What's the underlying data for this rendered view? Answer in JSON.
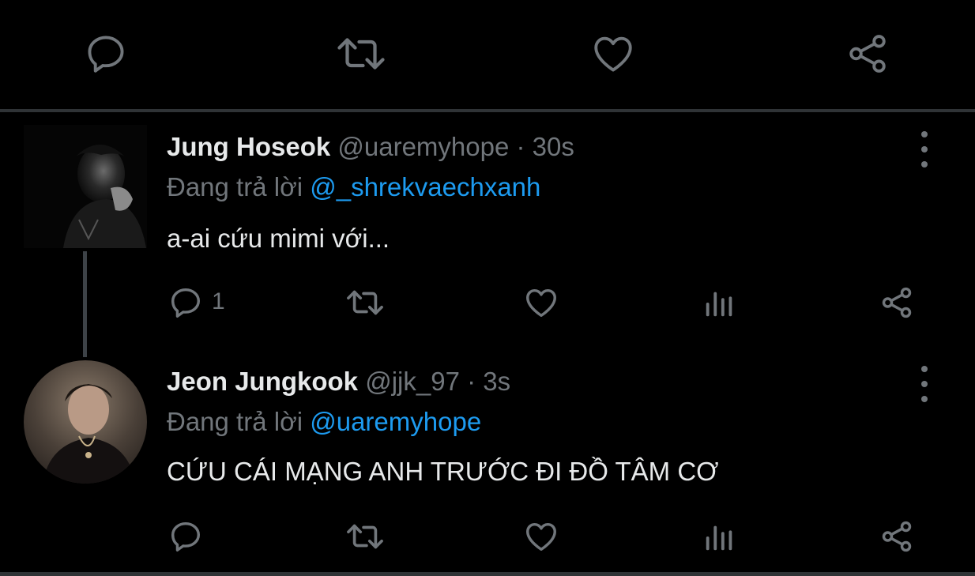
{
  "top_actions": {
    "reply_icon": "reply-icon",
    "retweet_icon": "retweet-icon",
    "like_icon": "heart-icon",
    "share_icon": "share-icon"
  },
  "tweets": [
    {
      "name": "Jung Hoseok",
      "handle": "@uaremyhope",
      "separator": "·",
      "time": "30s",
      "reply_prefix": "Đang trả lời",
      "reply_to": "@_shrekvaechxanh",
      "text": "a-ai cứu mimi với...",
      "reply_count": "1"
    },
    {
      "name": "Jeon Jungkook",
      "handle": "@jjk_97",
      "separator": "·",
      "time": "3s",
      "reply_prefix": "Đang trả lời",
      "reply_to": "@uaremyhope",
      "text": "CỨU CÁI MẠNG ANH TRƯỚC ĐI ĐỒ TÂM CƠ",
      "reply_count": ""
    }
  ],
  "colors": {
    "background": "#000000",
    "text": "#e7e9ea",
    "muted": "#71767b",
    "accent": "#1d9bf0",
    "divider": "#2f3336"
  }
}
